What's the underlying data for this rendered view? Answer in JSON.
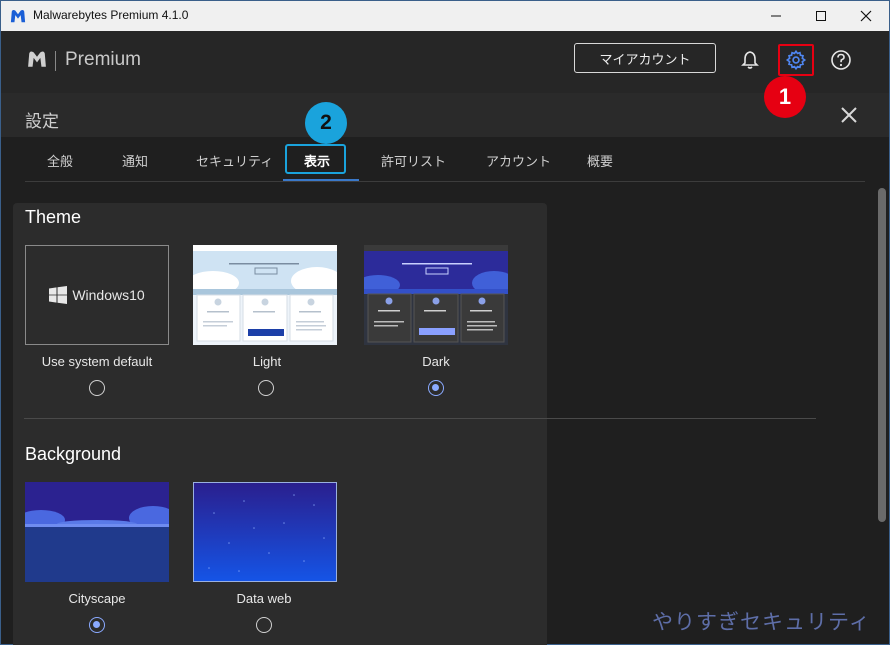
{
  "window": {
    "title": "Malwarebytes Premium  4.1.0"
  },
  "header": {
    "brand": "Premium",
    "account_button": "マイアカウント"
  },
  "annotations": {
    "step1": "1",
    "step2": "2"
  },
  "settings": {
    "title": "設定"
  },
  "tabs": [
    {
      "label": "全般"
    },
    {
      "label": "通知"
    },
    {
      "label": "セキュリティ"
    },
    {
      "label": "表示",
      "active": true
    },
    {
      "label": "許可リスト"
    },
    {
      "label": "アカウント"
    },
    {
      "label": "概要"
    }
  ],
  "theme": {
    "heading": "Theme",
    "options": [
      {
        "label": "Use system default",
        "thumb_text": "Windows10",
        "selected": false
      },
      {
        "label": "Light",
        "selected": false
      },
      {
        "label": "Dark",
        "selected": true
      }
    ]
  },
  "background": {
    "heading": "Background",
    "options": [
      {
        "label": "Cityscape",
        "selected": true
      },
      {
        "label": "Data web",
        "selected": false
      }
    ]
  },
  "watermark": "やりすぎセキュリティ",
  "colors": {
    "accent": "#3a78c9",
    "highlight_red": "#e60012",
    "highlight_blue": "#1aa3dc",
    "radio_selected": "#8aaaff"
  }
}
